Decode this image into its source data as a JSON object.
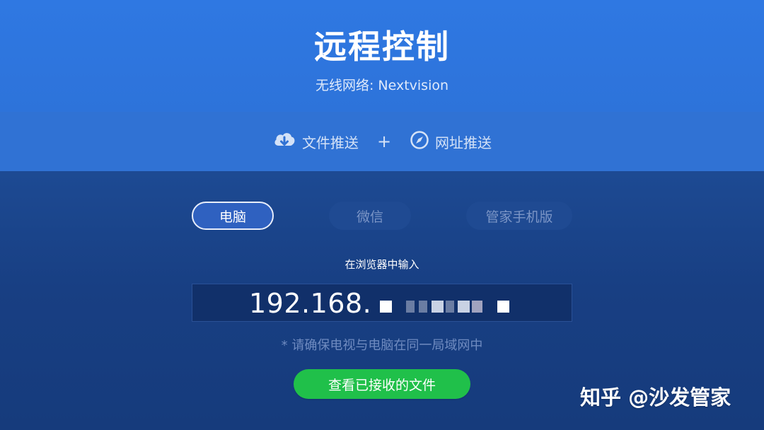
{
  "header": {
    "title": "远程控制",
    "network_label": "无线网络: Nextvision"
  },
  "push_bar": {
    "file_push_label": "文件推送",
    "separator": "+",
    "url_push_label": "网址推送",
    "file_push_icon": "cloud-download-icon",
    "url_push_icon": "compass-icon"
  },
  "tabs": [
    {
      "label": "电脑",
      "active": true
    },
    {
      "label": "微信",
      "active": false
    },
    {
      "label": "管家手机版",
      "active": false
    }
  ],
  "instruction": "在浏览器中输入",
  "address": {
    "visible_prefix": "192.168.",
    "redacted": true
  },
  "network_hint": "* 请确保电视与电脑在同一局域网中",
  "view_files_button": "查看已接收的文件",
  "watermark": "知乎 @沙发管家",
  "colors": {
    "header_blue": "#2f78e2",
    "main_blue": "#183f83",
    "accent_green": "#20c04a",
    "active_tab": "#2f61c0"
  }
}
